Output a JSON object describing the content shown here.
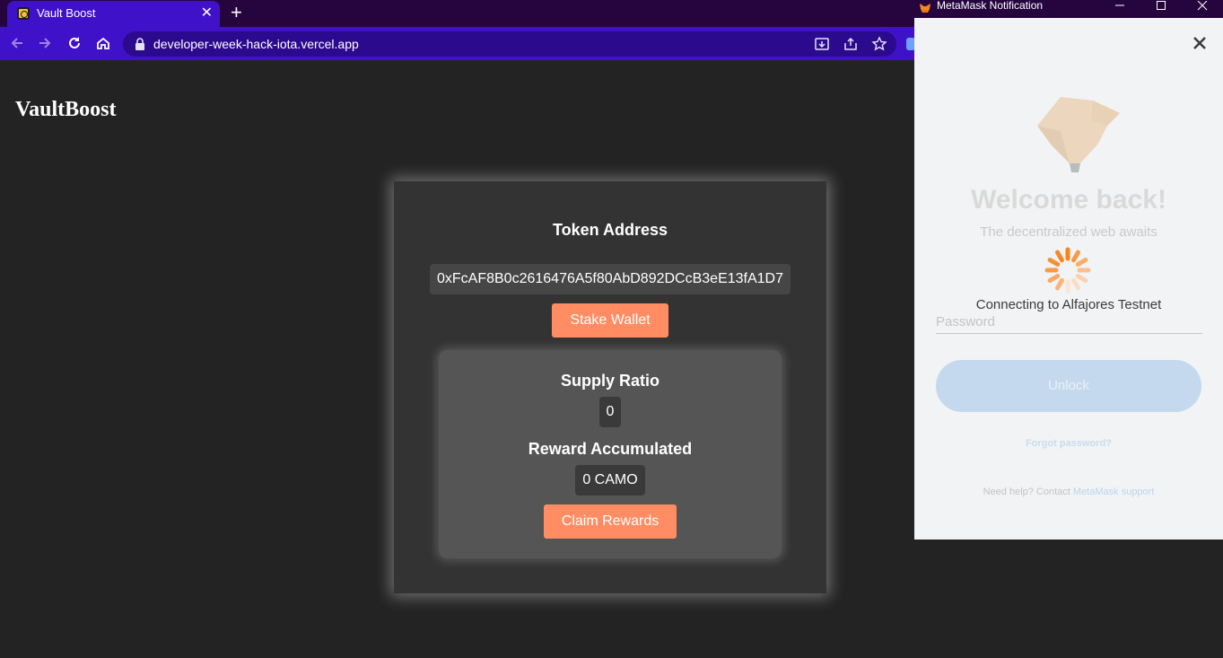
{
  "browser": {
    "tab_title": "Vault Boost",
    "tab_close": "✕",
    "new_tab": "+",
    "url": "developer-week-hack-iota.vercel.app"
  },
  "page": {
    "brand": "VaultBoost",
    "token_address_label": "Token Address",
    "token_address": "0xFcAF8B0c2616476A5f80AbD892DCcB3eE13fA1D7",
    "stake_button": "Stake Wallet",
    "supply_ratio_label": "Supply Ratio",
    "supply_ratio_value": "0",
    "reward_label": "Reward Accumulated",
    "reward_value": "0 CAMO",
    "claim_button": "Claim Rewards"
  },
  "metamask": {
    "window_title": "MetaMask Notification",
    "welcome": "Welcome back!",
    "tagline": "The decentralized web awaits",
    "connecting": "Connecting to Alfajores Testnet",
    "password_placeholder": "Password",
    "unlock_button": "Unlock",
    "forgot_password": "Forgot password?",
    "help_text": "Need help? Contact",
    "help_link": "MetaMask support"
  },
  "colors": {
    "browser_accent": "#3f11c9",
    "page_bg": "#232323",
    "button_orange": "#ff8c63",
    "metamask_bg": "#f2f3f4"
  }
}
